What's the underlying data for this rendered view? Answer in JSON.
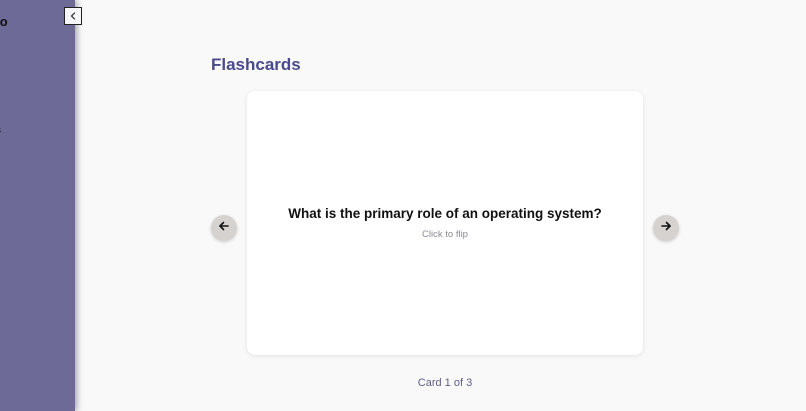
{
  "sidebar": {
    "brand": "mo",
    "item_fragment": "s",
    "background": "#6d6a98",
    "collapse_icon": "chevron-left-icon"
  },
  "main": {
    "title": "Flashcards",
    "title_color": "#4a4a8c"
  },
  "card": {
    "question": "What is the primary role of an operating system?",
    "hint": "Click to flip"
  },
  "navigation": {
    "prev_icon": "arrow-left-icon",
    "next_icon": "arrow-right-icon"
  },
  "counter": "Card 1 of 3"
}
